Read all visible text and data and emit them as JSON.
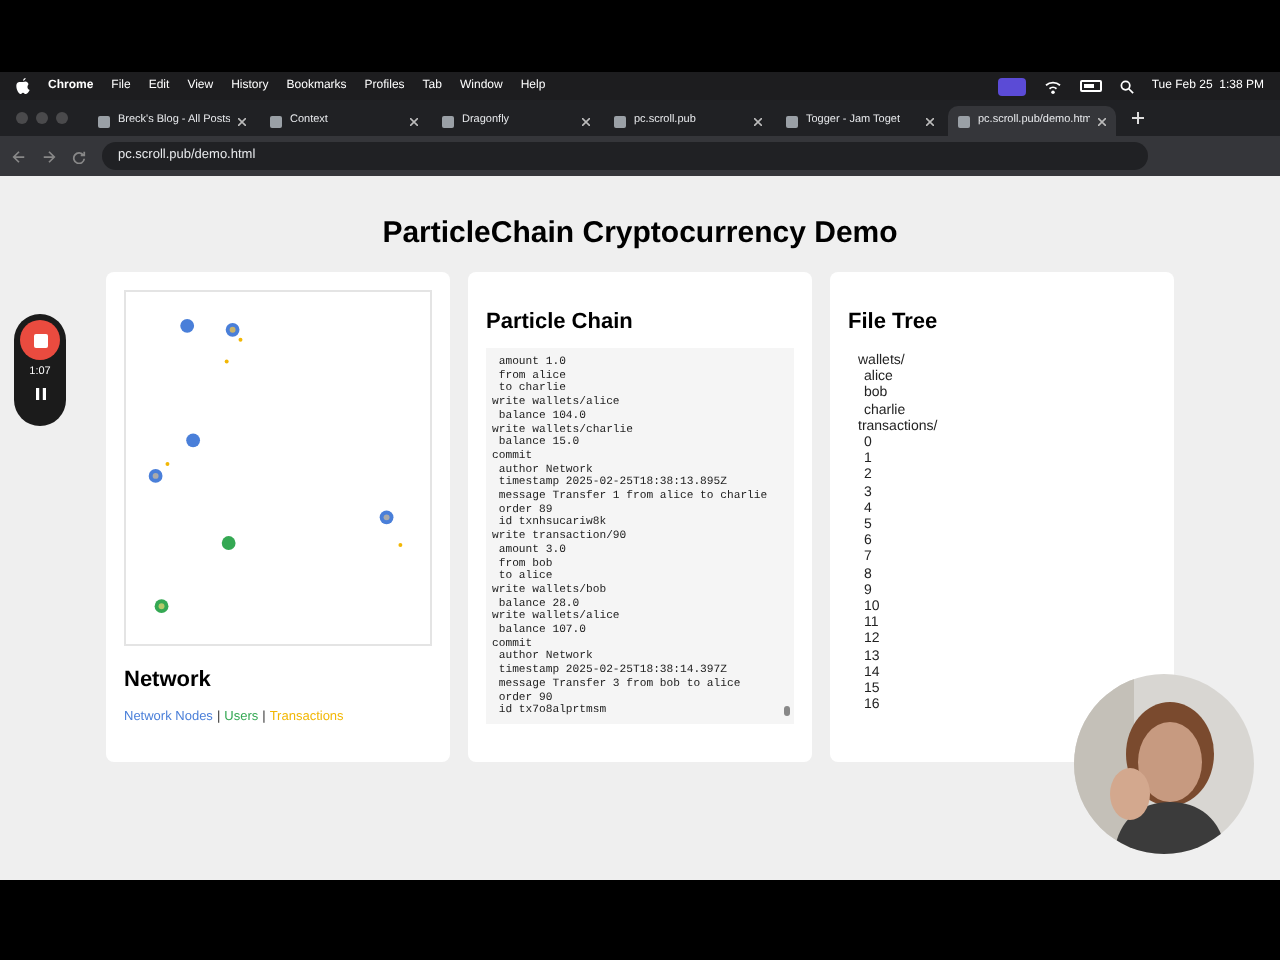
{
  "menu_bar": {
    "app": "Chrome",
    "items": [
      "File",
      "Edit",
      "View",
      "History",
      "Bookmarks",
      "Profiles",
      "Tab",
      "Window",
      "Help"
    ],
    "clock": "Tue Feb 25  1:38 PM"
  },
  "tabs": [
    {
      "label": "Breck's Blog - All Posts",
      "selected": false
    },
    {
      "label": "Context",
      "selected": false
    },
    {
      "label": "Dragonfly",
      "selected": false
    },
    {
      "label": "pc.scroll.pub",
      "selected": false
    },
    {
      "label": "Togger - Jam Toget",
      "selected": false
    },
    {
      "label": "pc.scroll.pub/demo.htm",
      "selected": true
    }
  ],
  "address_bar": {
    "url": "pc.scroll.pub/demo.html"
  },
  "recorder": {
    "time": "1:07"
  },
  "page": {
    "title": "ParticleChain Cryptocurrency Demo",
    "network": {
      "heading": "Network",
      "legend": [
        {
          "label": "Network Nodes",
          "color": "#4a7fd9"
        },
        {
          "label": "Users",
          "color": "#34a853"
        },
        {
          "label": "Transactions",
          "color": "#f2b705"
        }
      ],
      "separator": "|"
    },
    "chain": {
      "heading": "Particle Chain",
      "log": [
        " amount 1.0",
        " from alice",
        " to charlie",
        "write wallets/alice",
        " balance 104.0",
        "write wallets/charlie",
        " balance 15.0",
        "commit",
        " author Network",
        " timestamp 2025-02-25T18:38:13.895Z",
        " message Transfer 1 from alice to charlie",
        " order 89",
        " id txnhsucariw8k",
        "write transaction/90",
        " amount 3.0",
        " from bob",
        " to alice",
        "write wallets/bob",
        " balance 28.0",
        "write wallets/alice",
        " balance 107.0",
        "commit",
        " author Network",
        " timestamp 2025-02-25T18:38:14.397Z",
        " message Transfer 3 from bob to alice",
        " order 90",
        " id tx7o8alprtmsm"
      ]
    },
    "file_tree": {
      "heading": "File Tree",
      "items": [
        {
          "label": "wallets/",
          "children": [
            {
              "label": "alice"
            },
            {
              "label": "bob"
            },
            {
              "label": "charlie"
            }
          ]
        },
        {
          "label": "transactions/",
          "children": [
            {
              "label": "0"
            },
            {
              "label": "1"
            },
            {
              "label": "2"
            },
            {
              "label": "3"
            },
            {
              "label": "4"
            },
            {
              "label": "5"
            },
            {
              "label": "6"
            },
            {
              "label": "7"
            },
            {
              "label": "8"
            },
            {
              "label": "9"
            },
            {
              "label": "10"
            },
            {
              "label": "11"
            },
            {
              "label": "12"
            },
            {
              "label": "13"
            },
            {
              "label": "14"
            },
            {
              "label": "15"
            },
            {
              "label": "16"
            }
          ]
        }
      ]
    }
  }
}
